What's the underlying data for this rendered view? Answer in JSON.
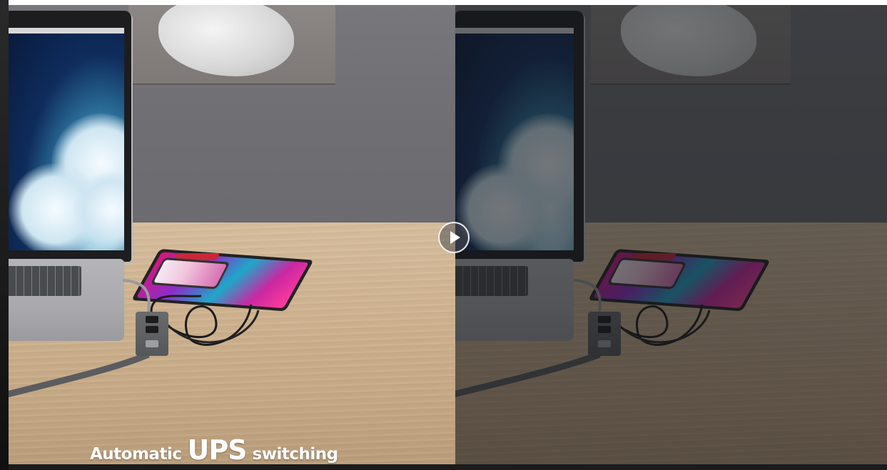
{
  "video": {
    "caption": {
      "part1": "Automatic",
      "part2": "UPS",
      "part3": "switching"
    },
    "play_icon": "play-icon",
    "colors": {
      "table": "#cfb391",
      "wall": "#6f6f74",
      "dim_overlay": "rgba(20,22,26,0.58)"
    }
  }
}
